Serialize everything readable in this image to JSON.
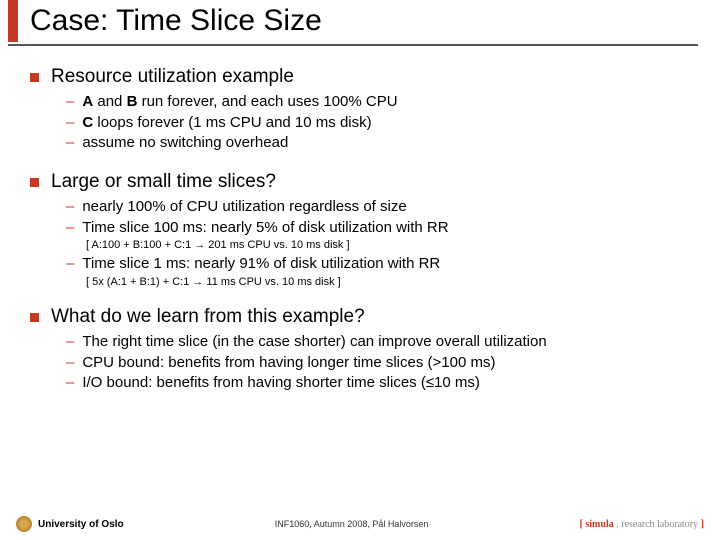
{
  "title": "Case: Time Slice Size",
  "sec1": {
    "head": "Resource utilization example",
    "b1": "<b>A</b> and <b>B</b> run forever, and each uses 100% CPU",
    "b2": "<b>C</b> loops forever (1 ms CPU and 10 ms disk)",
    "b3": "assume no switching overhead"
  },
  "sec2": {
    "head": "Large or small time slices?",
    "b1": "nearly 100% of CPU utilization regardless of size",
    "b2": "Time slice 100 ms: nearly 5% of disk utilization with RR",
    "n2": "[ A:100 + B:100 + C:1 → 201 ms CPU  vs. 10 ms disk ]",
    "b3": "Time slice 1 ms: nearly 91% of disk utilization with RR",
    "n3": "[ 5x (A:1 + B:1) + C:1 → 11 ms CPU vs. 10 ms disk ]"
  },
  "sec3": {
    "head": "What do we learn from this example?",
    "b1": "The right time slice (in the case shorter) can improve overall utilization",
    "b2": "CPU bound: benefits from having longer time slices (>100 ms)",
    "b3": "I/O bound: benefits from having shorter time slices (≤10 ms)"
  },
  "footer": {
    "left": "University of Oslo",
    "center": "INF1060, Autumn 2008, Pål Halvorsen",
    "right_a": "[ ",
    "right_b": "simula",
    "right_c": " . research laboratory",
    "right_d": " ]"
  }
}
